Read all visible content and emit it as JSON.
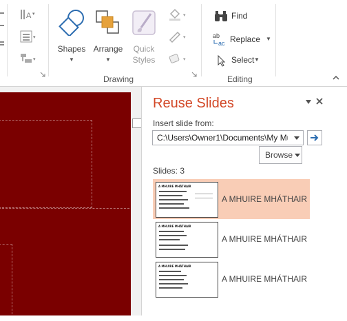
{
  "ribbon": {
    "drawing": {
      "shapes_label": "Shapes",
      "arrange_label": "Arrange",
      "quick_styles_label_1": "Quick",
      "quick_styles_label_2": "Styles",
      "group_label": "Drawing"
    },
    "editing": {
      "find_label": "Find",
      "replace_label": "Replace",
      "select_label": "Select",
      "group_label": "Editing"
    }
  },
  "reuse_pane": {
    "title": "Reuse Slides",
    "insert_label": "Insert slide from:",
    "path_value": "C:\\Users\\Owner1\\Documents\\My Mu",
    "browse_label": "Browse",
    "slides_count": "Slides: 3",
    "slides": [
      {
        "name": "A MHUIRE MHÁTHAIR",
        "thumb_title": "A MHUIRE MHÁTHAIR",
        "selected": true
      },
      {
        "name": "A MHUIRE MHÁTHAIR",
        "thumb_title": "A MHUIRE MHÁTHAIR",
        "selected": false
      },
      {
        "name": "A MHUIRE MHÁTHAIR",
        "thumb_title": "A MHUIRE MHÁTHAIR",
        "selected": false
      }
    ]
  },
  "colors": {
    "slide_bg": "#7a0000",
    "pane_title": "#d24726",
    "selected_row": "#f9cdb6",
    "hyperlink_blue": "#2b6cb0"
  },
  "icons": [
    "shapes-icon",
    "arrange-icon",
    "quick-styles-icon",
    "shape-fill-icon",
    "shape-outline-icon",
    "shape-effects-icon",
    "binoculars-icon",
    "replace-icon",
    "select-cursor-icon",
    "collapse-ribbon-icon",
    "pane-options-icon",
    "close-icon",
    "go-arrow-icon"
  ]
}
